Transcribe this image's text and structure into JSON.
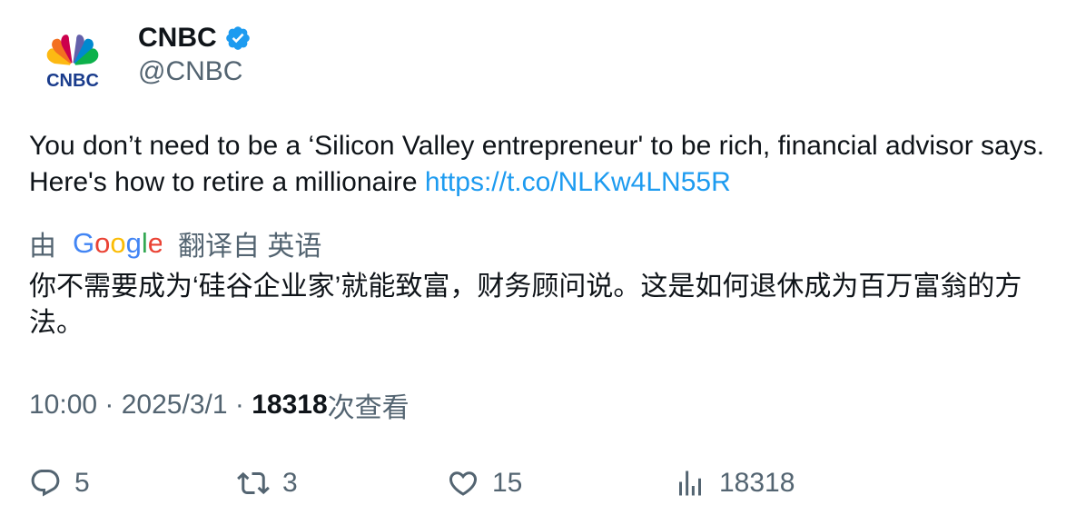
{
  "author": {
    "name": "CNBC",
    "handle": "@CNBC",
    "logo_text": "CNBC"
  },
  "tweet": {
    "text": "You don’t need to be a ‘Silicon Valley entrepreneur' to be rich, financial advisor says. Here's how to retire a millionaire ",
    "link": "https://t.co/NLKw4LN55R"
  },
  "translation": {
    "prefix": "由",
    "provider": "Google",
    "suffix": "翻译自 英语",
    "text": "你不需要成为‘硅谷企业家’就能致富，财务顾问说。这是如何退休成为百万富翁的方法。"
  },
  "meta": {
    "time": "10:00",
    "date": "2025/3/1",
    "views": "18318",
    "views_label": "次查看",
    "separator": " · "
  },
  "actions": {
    "replies": "5",
    "retweets": "3",
    "likes": "15",
    "views": "18318"
  },
  "colors": {
    "link": "#1d9bf0",
    "muted": "#536471",
    "text": "#0f1419",
    "verified": "#1d9bf0"
  }
}
